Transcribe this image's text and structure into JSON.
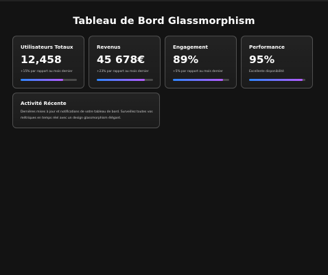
{
  "page": {
    "title": "Tableau de Bord Glassmorphism"
  },
  "colors": {
    "background": "#131313",
    "bar_start": "#2f86ff",
    "bar_end": "#b45cff",
    "bar_track": "#4a4a4a"
  },
  "stats": [
    {
      "title": "Utilisateurs Totaux",
      "value": "12,458",
      "sub": "+15% par rapport au mois dernier",
      "progress": 0.75
    },
    {
      "title": "Revenus",
      "value": "45 678€",
      "sub": "+23% par rapport au mois dernier",
      "progress": 0.85
    },
    {
      "title": "Engagement",
      "value": "89%",
      "sub": "+5% par rapport au mois dernier",
      "progress": 0.89
    },
    {
      "title": "Performance",
      "value": "95%",
      "sub": "Excellente disponibilité",
      "progress": 0.95
    }
  ],
  "activity": {
    "title": "Activité Récente",
    "description": "Dernières mises à jour et notifications de votre tableau de bord. Surveillez toutes vos métriques en temps réel avec un design glassmorphism élégant."
  }
}
